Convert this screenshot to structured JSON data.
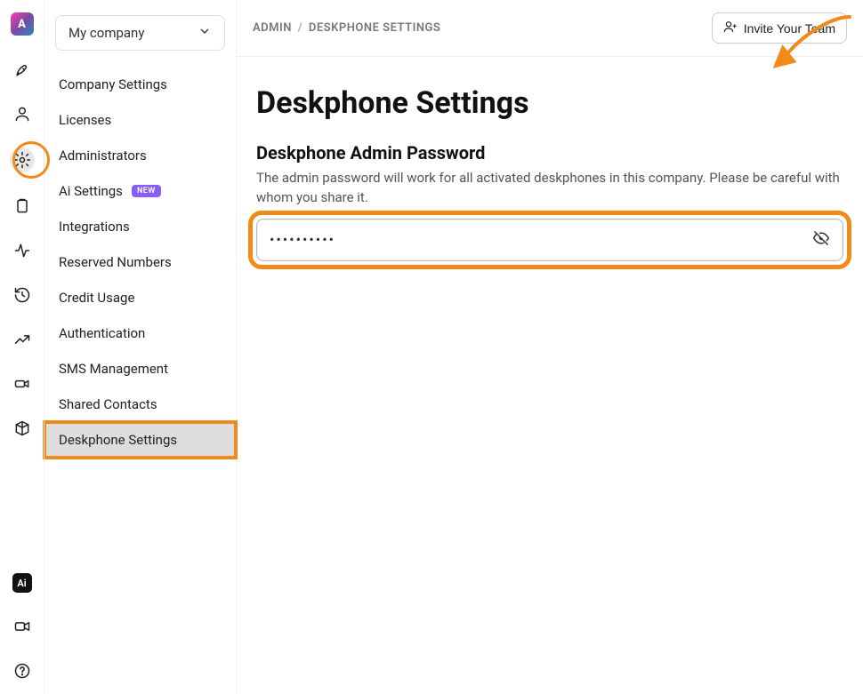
{
  "rail": {
    "logo_letter": "A"
  },
  "company_picker": {
    "label": "My company"
  },
  "nav": {
    "items": [
      {
        "label": "Company Settings"
      },
      {
        "label": "Licenses"
      },
      {
        "label": "Administrators"
      },
      {
        "label": "Ai Settings",
        "badge": "NEW"
      },
      {
        "label": "Integrations"
      },
      {
        "label": "Reserved Numbers"
      },
      {
        "label": "Credit Usage"
      },
      {
        "label": "Authentication"
      },
      {
        "label": "SMS Management"
      },
      {
        "label": "Shared Contacts"
      },
      {
        "label": "Deskphone Settings",
        "active": true
      }
    ]
  },
  "breadcrumbs": {
    "root": "Admin",
    "current": "Deskphone Settings"
  },
  "invite_button": {
    "label": "Invite Your Team"
  },
  "page": {
    "title": "Deskphone Settings",
    "section_title": "Deskphone Admin Password",
    "section_help": "The admin password will work for all activated deskphones in this company. Please be careful with whom you share it.",
    "password_value": "••••••••••",
    "password_visible": false
  },
  "annotations": {
    "gear_highlight_color": "#f28a1a",
    "password_outline_color": "#f28a1a",
    "arrow_color": "#f28a1a"
  }
}
